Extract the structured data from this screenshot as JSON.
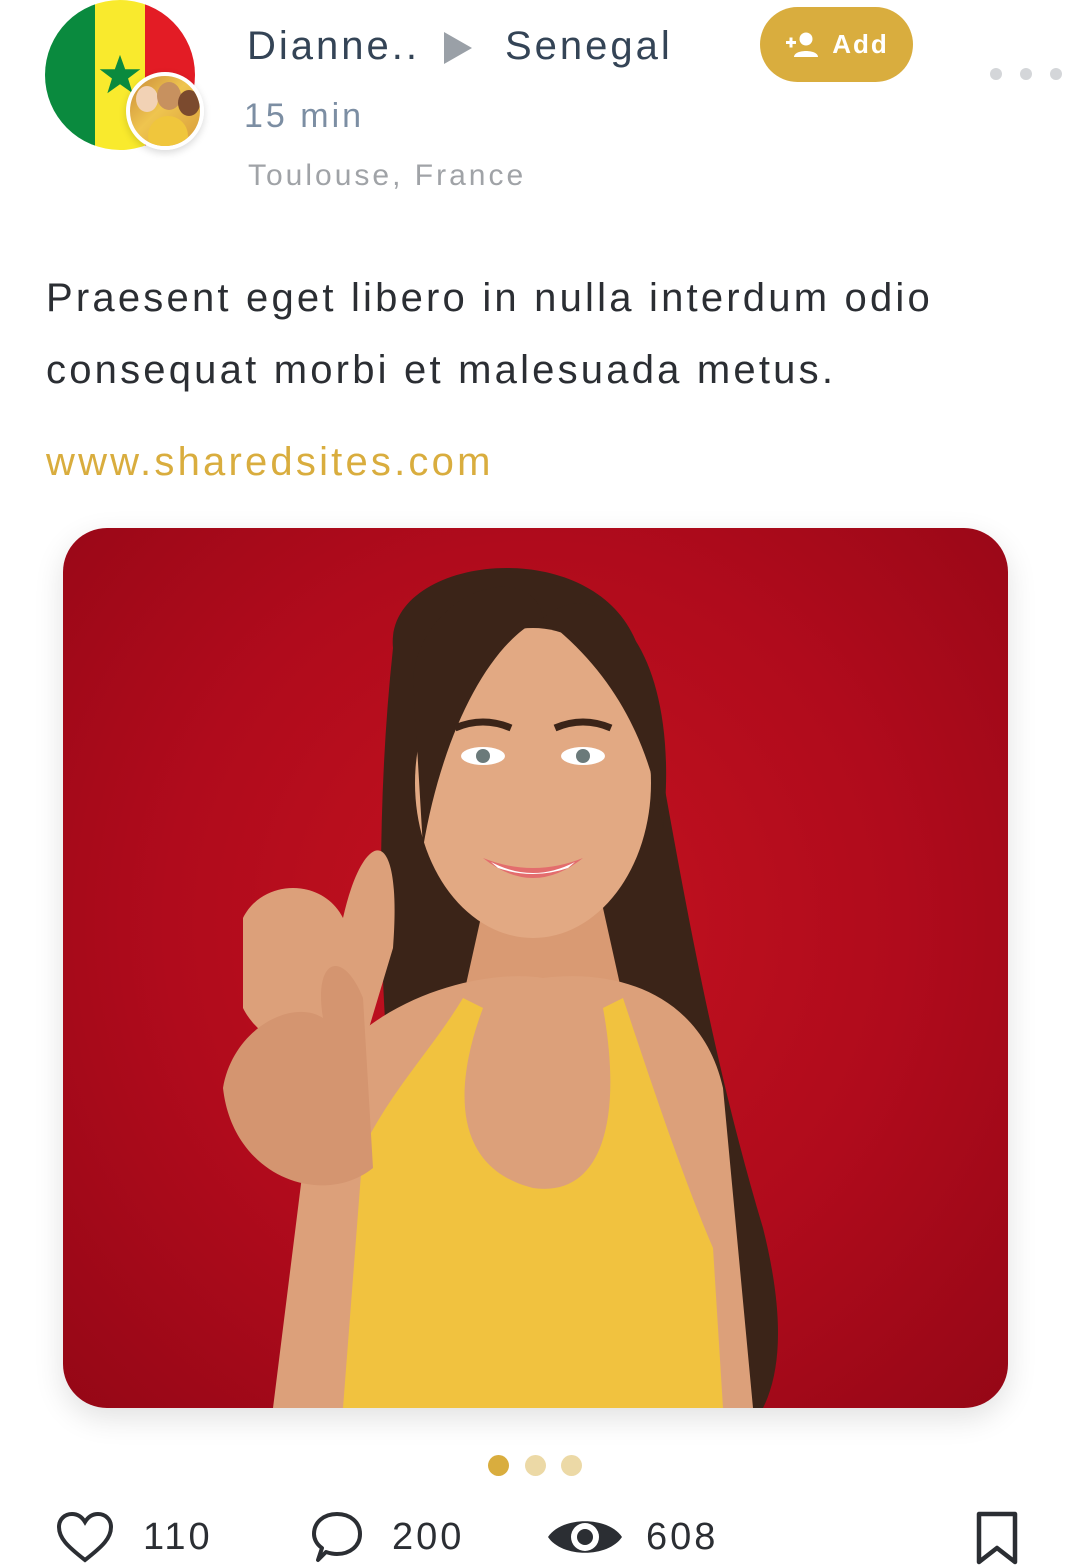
{
  "header": {
    "name": "Dianne..",
    "country": "Senegal",
    "time_ago": "15 min",
    "location": "Toulouse, France",
    "add_label": "Add",
    "flag_colors": [
      "#0a8a3e",
      "#f9ea2d",
      "#e31c25"
    ],
    "more_icon": "more-horizontal-icon"
  },
  "post": {
    "caption": "Praesent eget libero in nulla interdum odio consequat morbi et malesuada metus.",
    "link": "www.sharedsites.com",
    "image_description_icon": "photo",
    "carousel": {
      "total": 3,
      "active_index": 0
    }
  },
  "actions": {
    "likes": "110",
    "comments": "200",
    "views": "608"
  },
  "colors": {
    "accent": "#d9ad3e",
    "text": "#2b2e33",
    "muted": "#a0a3a7"
  }
}
